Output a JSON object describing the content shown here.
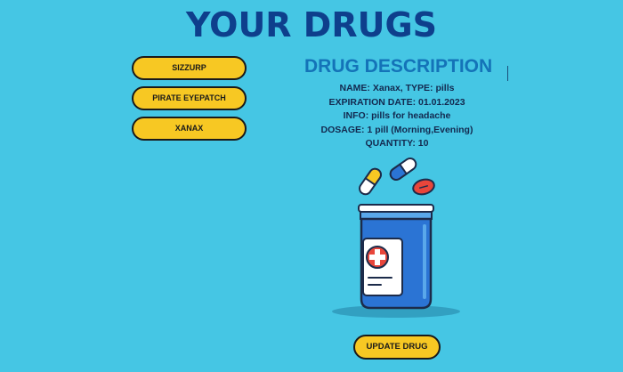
{
  "header": {
    "title": "YOUR DRUGS"
  },
  "drug_list": {
    "items": [
      {
        "label": "SIZZURP"
      },
      {
        "label": "PIRATE EYEPATCH"
      },
      {
        "label": "XANAX"
      }
    ]
  },
  "description": {
    "heading": "DRUG DESCRIPTION",
    "lines": [
      "NAME: Xanax, TYPE: pills",
      "EXPIRATION DATE: 01.01.2023",
      "INFO: pills for headache",
      "DOSAGE: 1 pill (Morning,Evening)",
      "QUANTITY: 10"
    ]
  },
  "illustration": {
    "icon": "pill-bottle-icon"
  },
  "actions": {
    "update_label": "UPDATE DRUG"
  },
  "colors": {
    "background": "#45c6e4",
    "title": "#0e3f8c",
    "heading": "#1473b8",
    "button": "#f7c823",
    "bottle": "#2b74d4"
  }
}
